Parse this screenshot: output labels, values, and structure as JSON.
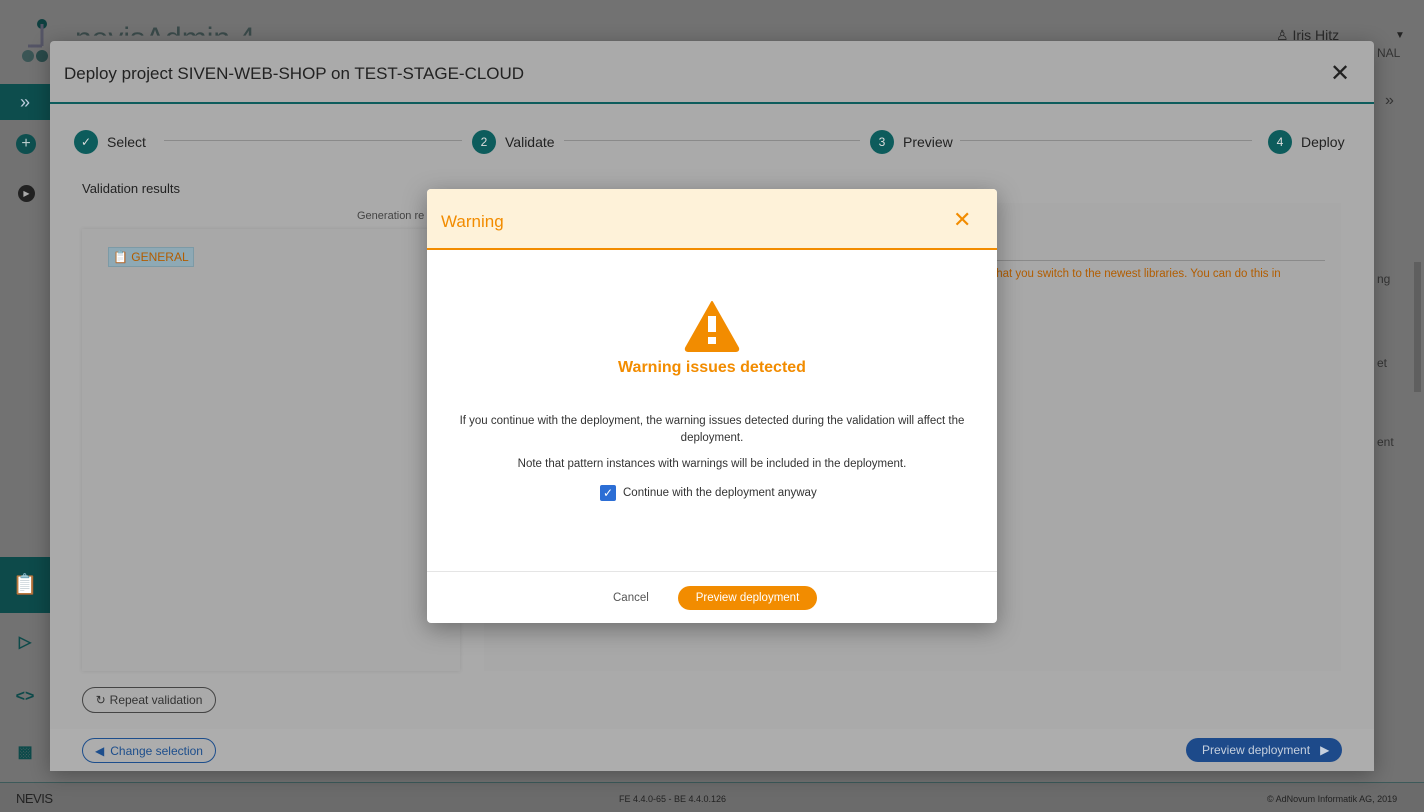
{
  "app": {
    "title": "nevisAdmin 4",
    "user": "Iris Hitz",
    "user_suffix_fragment": "NAL",
    "right_fragments": [
      "ng",
      "et",
      "ent"
    ]
  },
  "footer": {
    "brand": "NEVIS",
    "version": "FE 4.4.0-65 - BE 4.4.0.126",
    "copyright": "© AdNovum Informatik AG, 2019"
  },
  "modal": {
    "title": "Deploy project SIVEN-WEB-SHOP on TEST-STAGE-CLOUD",
    "steps": [
      {
        "number": "✓",
        "label": "Select",
        "state": "done"
      },
      {
        "number": "2",
        "label": "Validate",
        "state": "current"
      },
      {
        "number": "3",
        "label": "Preview",
        "state": "pending"
      },
      {
        "number": "4",
        "label": "Deploy",
        "state": "pending"
      }
    ],
    "validation_results_label": "Validation results",
    "generation_label_fragment": "Generation re",
    "general_tag": "GENERAL",
    "message_fragment": "that you switch to the newest libraries. You can do this in",
    "repeat_validation": "Repeat validation",
    "change_selection": "Change selection",
    "preview_deployment": "Preview deployment"
  },
  "warning": {
    "title": "Warning",
    "heading": "Warning issues detected",
    "text1": "If you continue with the deployment, the warning issues detected during the validation will affect the deployment.",
    "text2": "Note that pattern instances with warnings will be included in the deployment.",
    "checkbox_label": "Continue with the deployment anyway",
    "checkbox_checked": true,
    "cancel": "Cancel",
    "confirm": "Preview deployment",
    "accent_color": "#f28c00"
  },
  "colors": {
    "teal": "#0d5c5c",
    "blue": "#1d4a8a",
    "orange": "#f28c00"
  }
}
